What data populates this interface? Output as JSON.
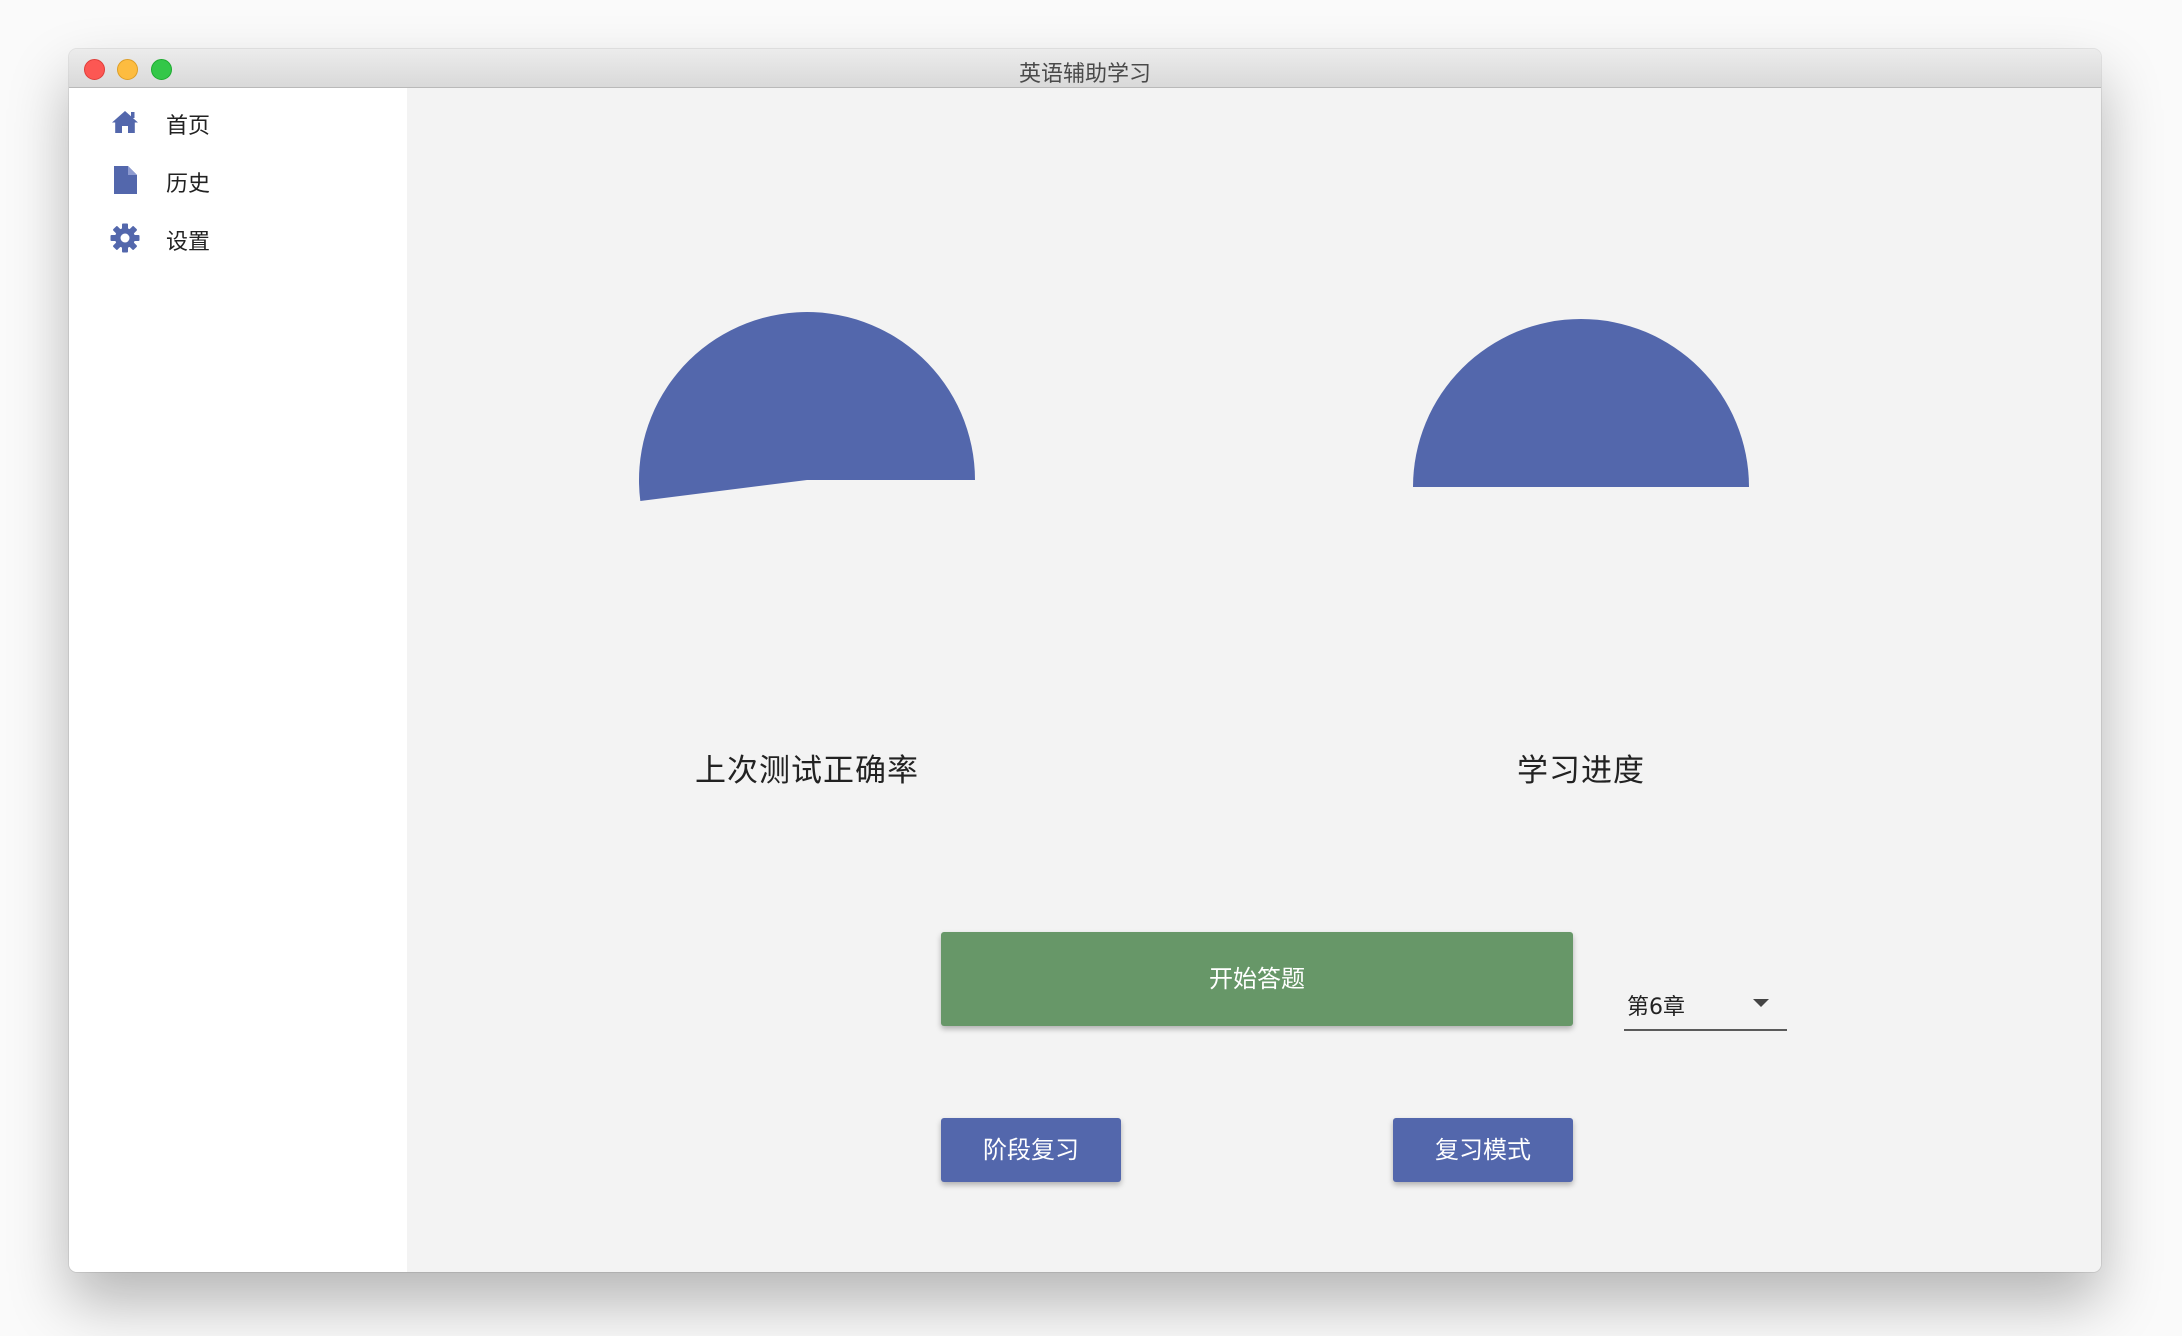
{
  "window": {
    "title": "英语辅助学习"
  },
  "sidebar": {
    "items": [
      {
        "label": "首页",
        "icon": "home-icon"
      },
      {
        "label": "历史",
        "icon": "document-icon"
      },
      {
        "label": "设置",
        "icon": "gear-icon"
      }
    ]
  },
  "main": {
    "gauges": [
      {
        "title": "上次测试正确率",
        "value_fraction": 0.52
      },
      {
        "title": "学习进度",
        "value_fraction": 0.5
      }
    ],
    "start_button": "开始答题",
    "chapter_select": {
      "selected": "第6章"
    },
    "stage_review_button": "阶段复习",
    "review_mode_button": "复习模式"
  },
  "colors": {
    "accent": "#5367ac",
    "start_button": "#679768",
    "window_bg": "#f3f3f3",
    "sidebar_bg": "#ffffff"
  }
}
